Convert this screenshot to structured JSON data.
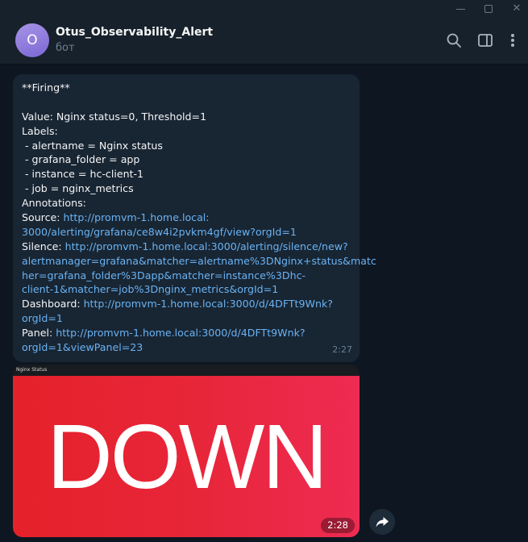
{
  "window": {
    "minimize_icon": "minimize-icon",
    "maximize_icon": "maximize-icon",
    "close_glyph": "✕"
  },
  "header": {
    "avatar_letter": "O",
    "title": "Otus_Observability_Alert",
    "status": "бот",
    "icons": [
      "search-icon",
      "sidebar-panel-icon",
      "more-vertical-icon"
    ]
  },
  "message": {
    "lines": [
      {
        "label": "**Firing**",
        "link": ""
      },
      {
        "label": "",
        "link": ""
      },
      {
        "label": "Value: Nginx status=0, Threshold=1",
        "link": ""
      },
      {
        "label": "Labels:",
        "link": ""
      },
      {
        "label": " - alertname = Nginx status",
        "link": ""
      },
      {
        "label": " - grafana_folder = app",
        "link": ""
      },
      {
        "label": " - instance = hc-client-1",
        "link": ""
      },
      {
        "label": " - job = nginx_metrics",
        "link": ""
      },
      {
        "label": "Annotations:",
        "link": ""
      },
      {
        "label": "Source: ",
        "link": "http://promvm-1.home.local:"
      },
      {
        "label": "",
        "link": "3000/alerting/grafana/ce8w4i2pvkm4gf/view?orgId=1"
      },
      {
        "label": "Silence: ",
        "link": "http://promvm-1.home.local:3000/alerting/silence/new?"
      },
      {
        "label": "",
        "link": "alertmanager=grafana&matcher=alertname%3DNginx+status&matc"
      },
      {
        "label": "",
        "link": "her=grafana_folder%3Dapp&matcher=instance%3Dhc-"
      },
      {
        "label": "",
        "link": "client-1&matcher=job%3Dnginx_metrics&orgId=1"
      },
      {
        "label": "Dashboard: ",
        "link": "http://promvm-1.home.local:3000/d/4DFTt9Wnk?"
      },
      {
        "label": "",
        "link": "orgId=1"
      },
      {
        "label": "Panel: ",
        "link": "http://promvm-1.home.local:3000/d/4DFTt9Wnk?"
      },
      {
        "label": "",
        "link": "orgId=1&viewPanel=23"
      }
    ],
    "time": "2:27"
  },
  "photo": {
    "panel_title": "Nginx Status",
    "value_text": "DOWN",
    "time": "2:28",
    "colors": {
      "value_bg_start": "#e5212a",
      "value_bg_end": "#ee2b52",
      "panel_bg": "#181b1f"
    }
  },
  "actions": {
    "forward_icon": "forward-arrow-icon"
  },
  "theme": {
    "background": "#0e1621",
    "header_bg": "#17212b",
    "bubble_bg": "#182533",
    "link_color": "#6ab3f3",
    "avatar_color": "#8e7ee0"
  }
}
